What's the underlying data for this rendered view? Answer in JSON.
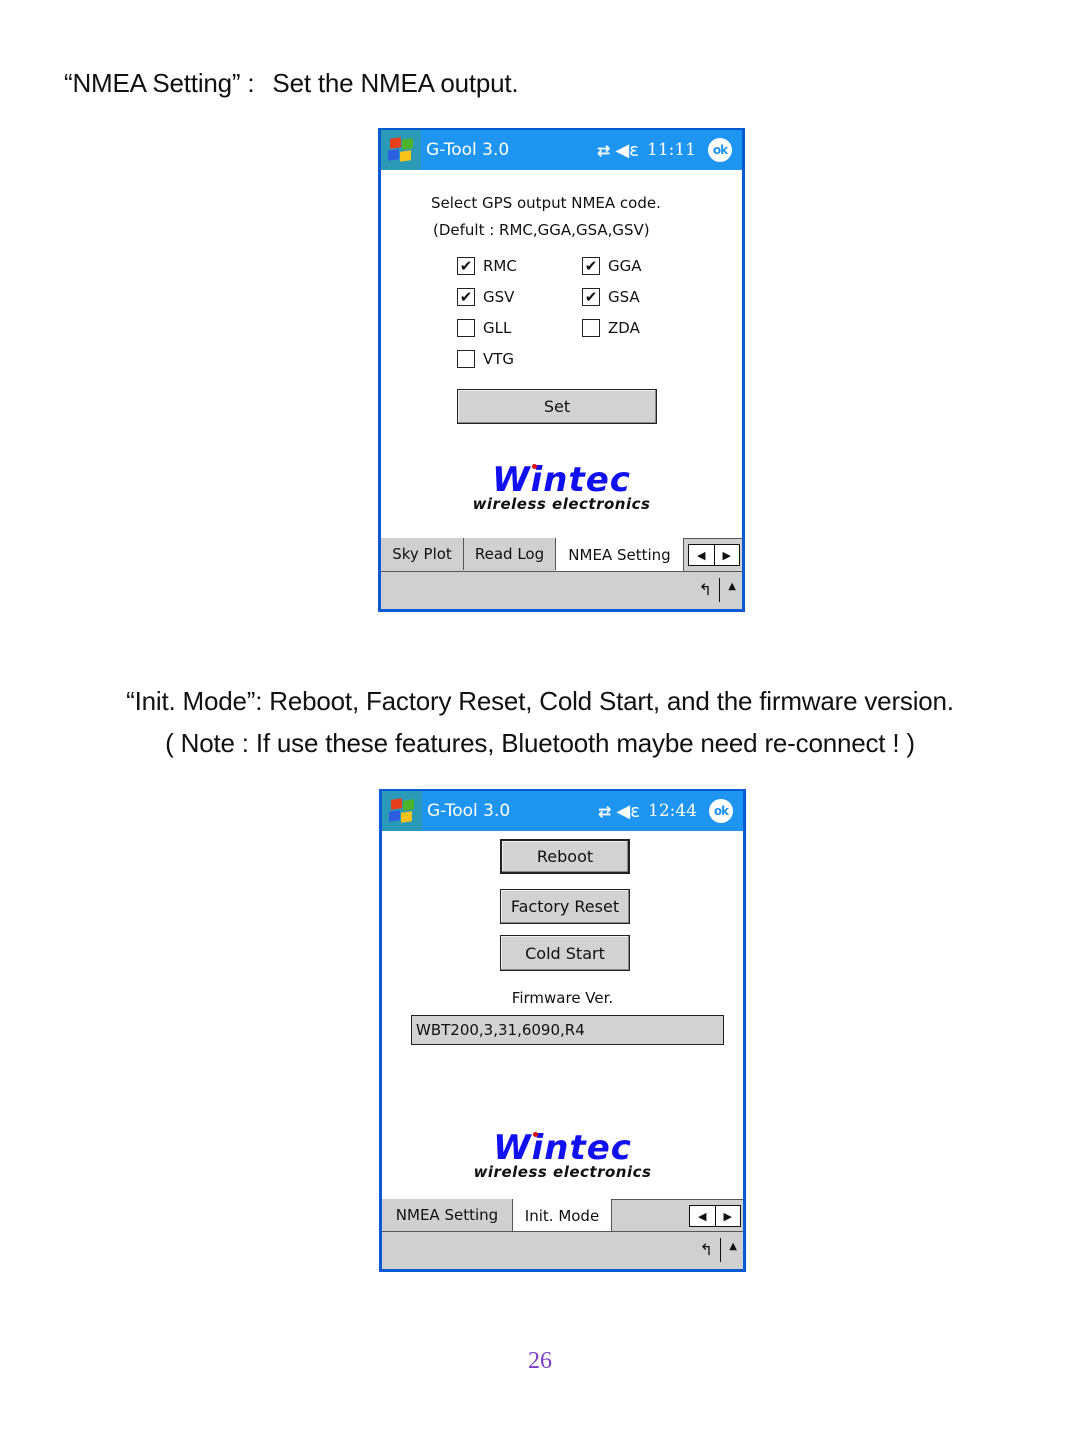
{
  "doc": {
    "section1_caption_label": "“NMEA Setting” :",
    "section1_caption_text": "Set the NMEA output.",
    "section2_caption": "“Init. Mode”: Reboot, Factory Reset, Cold Start, and the firmware version.",
    "section2_note": "( Note : If use these features, Bluetooth maybe need re-connect ! )",
    "page_number": "26"
  },
  "screen1": {
    "titlebar": {
      "app_title": "G-Tool 3.0",
      "connection_icon": "⇄",
      "volume_icon": "◀ε",
      "clock": "11:11",
      "ok_label": "ok"
    },
    "instruction_line1": "Select GPS output NMEA code.",
    "instruction_line2": "(Defult : RMC,GGA,GSA,GSV)",
    "checkboxes": [
      {
        "label": "RMC",
        "checked": true,
        "mark": "✔"
      },
      {
        "label": "GGA",
        "checked": true,
        "mark": "✔"
      },
      {
        "label": "GSV",
        "checked": true,
        "mark": "✔"
      },
      {
        "label": "GSA",
        "checked": true,
        "mark": "✔"
      },
      {
        "label": "GLL",
        "checked": false,
        "mark": ""
      },
      {
        "label": "ZDA",
        "checked": false,
        "mark": ""
      },
      {
        "label": "VTG",
        "checked": false,
        "mark": ""
      }
    ],
    "set_button": "Set",
    "logo": {
      "main": "Wintec",
      "sub": "wireless electronics"
    },
    "tabs": [
      {
        "label": "Sky Plot",
        "active": false
      },
      {
        "label": "Read Log",
        "active": false
      },
      {
        "label": "NMEA Setting",
        "active": true
      }
    ],
    "tab_scroll": {
      "left": "◀",
      "right": "▶"
    },
    "menubar": {
      "sip_icon": "↰",
      "sip_arrow": "▲"
    }
  },
  "screen2": {
    "titlebar": {
      "app_title": "G-Tool 3.0",
      "connection_icon": "⇄",
      "volume_icon": "◀ε",
      "clock": "12:44",
      "ok_label": "ok"
    },
    "buttons": {
      "reboot": "Reboot",
      "factory_reset": "Factory Reset",
      "cold_start": "Cold Start"
    },
    "firmware_label": "Firmware Ver.",
    "firmware_value": "WBT200,3,31,6090,R4",
    "logo": {
      "main": "Wintec",
      "sub": "wireless electronics"
    },
    "tabs": [
      {
        "label": "NMEA Setting",
        "active": false
      },
      {
        "label": "Init. Mode",
        "active": true
      }
    ],
    "tab_scroll": {
      "left": "◀",
      "right": "▶"
    },
    "menubar": {
      "sip_icon": "↰",
      "sip_arrow": "▲"
    }
  }
}
